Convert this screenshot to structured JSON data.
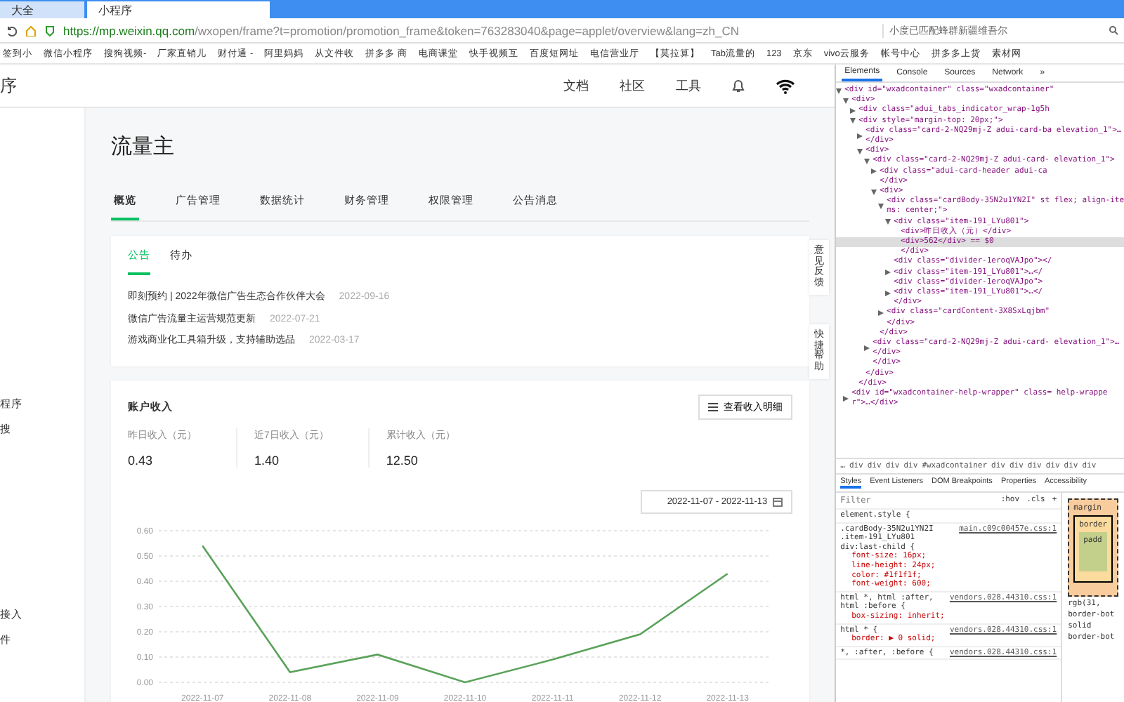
{
  "browser": {
    "tabs": [
      {
        "title": "大全",
        "selected": false
      },
      {
        "title": "小程序",
        "selected": true
      }
    ],
    "url_host": "https://mp.weixin.qq.com",
    "url_path": "/wxopen/frame?t=promotion/promotion_frame&token=763283040&page=applet/overview&lang=zh_CN",
    "search": "小度已匹配蜂群新疆维吾尔",
    "bookmarks": [
      "签到小",
      "微信小程序",
      "搜狗视频-",
      "厂家直销儿",
      "财付通 -",
      "阿里妈妈",
      "从文件收",
      "拼多多 商",
      "电商课堂",
      "快手视频互",
      "百度短网址",
      "电信营业厅",
      "【莫拉算】",
      "Tab流量的",
      "123",
      "京东",
      "vivo云服务",
      "帐号中心",
      "拼多多上货",
      "素材网"
    ]
  },
  "header": {
    "logo_fragment": "序",
    "links": [
      "文档",
      "社区",
      "工具"
    ]
  },
  "sidebar": {
    "groups": [
      {
        "items": [
          "程序",
          "搜"
        ]
      },
      {
        "items": [
          "接入",
          "件"
        ]
      }
    ]
  },
  "page": {
    "title": "流量主",
    "tabs": [
      {
        "label": "概览",
        "selected": true
      },
      {
        "label": "广告管理",
        "selected": false
      },
      {
        "label": "数据统计",
        "selected": false
      },
      {
        "label": "财务管理",
        "selected": false
      },
      {
        "label": "权限管理",
        "selected": false
      },
      {
        "label": "公告消息",
        "selected": false
      }
    ],
    "notice_card": {
      "tabs": [
        {
          "label": "公告",
          "selected": true
        },
        {
          "label": "待办",
          "selected": false
        }
      ],
      "notices": [
        {
          "text": "即刻预约 | 2022年微信广告生态合作伙伴大会",
          "date": "2022-09-16"
        },
        {
          "text": "微信广告流量主运营规范更新",
          "date": "2022-07-21"
        },
        {
          "text": "游戏商业化工具箱升级，支持辅助选品",
          "date": "2022-03-17"
        }
      ]
    },
    "income_card": {
      "title": "账户收入",
      "detail_button": "查看收入明细",
      "stats": [
        {
          "label": "昨日收入（元）",
          "value": "0.43"
        },
        {
          "label": "近7日收入（元）",
          "value": "1.40"
        },
        {
          "label": "累计收入（元）",
          "value": "12.50"
        }
      ],
      "date_range": "2022-11-07 - 2022-11-13",
      "chart_data": {
        "type": "line",
        "categories": [
          "2022-11-07",
          "2022-11-08",
          "2022-11-09",
          "2022-11-10",
          "2022-11-11",
          "2022-11-12",
          "2022-11-13"
        ],
        "grid": true,
        "series": [
          {
            "color": "#5aa25a",
            "values": [
              0.54,
              0.04,
              0.11,
              0.0,
              0.09,
              0.19,
              0.43
            ]
          }
        ],
        "ylim": [
          0,
          0.6
        ],
        "yticks": [
          {
            "value": 0,
            "label": "0.00"
          },
          {
            "value": 0.1,
            "label": "0.10"
          },
          {
            "value": 0.2,
            "label": "0.20"
          },
          {
            "value": 0.3,
            "label": "0.30"
          },
          {
            "value": 0.4,
            "label": "0.40"
          },
          {
            "value": 0.5,
            "label": "0.50"
          },
          {
            "value": 0.6,
            "label": "0.60"
          }
        ]
      }
    }
  },
  "floating_buttons": [
    "意见反馈",
    "快捷帮助"
  ],
  "devtools": {
    "tabs": [
      {
        "label": "Elements",
        "selected": true
      },
      {
        "label": "Console",
        "selected": false
      },
      {
        "label": "Sources",
        "selected": false
      },
      {
        "label": "Network",
        "selected": false
      },
      {
        "label": "»",
        "selected": false
      }
    ],
    "tree": [
      {
        "text": "<div id=\"wxadcontainer\" class=\"wxadcontainer\"",
        "kind": "expanded",
        "selected": false,
        "children": [
          {
            "text": "<div>",
            "kind": "expanded",
            "selected": false,
            "children": [
              {
                "text": "<div class=\"adui_tabs_indicator_wrap-1g5h",
                "kind": "collapsed",
                "selected": false
              },
              {
                "text": "<div style=\"margin-top: 20px;\">",
                "kind": "expanded",
                "selected": false,
                "children": [
                  {
                    "text": "<div class=\"card-2-NQ29mj-Z adui-card-ba elevation_1\">…</div>",
                    "kind": "collapsed",
                    "selected": false
                  },
                  {
                    "text": "<div>",
                    "kind": "expanded",
                    "selected": false,
                    "children": [
                      {
                        "text": "<div class=\"card-2-NQ29mj-Z adui-card- elevation_1\">",
                        "kind": "expanded",
                        "selected": false,
                        "children": [
                          {
                            "text": "<div class=\"adui-card-header adui-ca",
                            "kind": "collapsed",
                            "selected": false
                          },
                          {
                            "text": "</div>",
                            "kind": "plain",
                            "selected": false
                          },
                          {
                            "text": "<div>",
                            "kind": "expanded",
                            "selected": false,
                            "children": [
                              {
                                "text": "<div class=\"cardBody-35N2u1YN2I\" st flex; align-items: center;\">",
                                "kind": "expanded",
                                "selected": false,
                                "children": [
                                  {
                                    "text": "<div class=\"item-191_LYu801\">",
                                    "kind": "expanded",
                                    "selected": false,
                                    "children": [
                                      {
                                        "text": "<div>昨日收入（元）</div>",
                                        "kind": "plain",
                                        "selected": false
                                      },
                                      {
                                        "text": "<div>562</div> == $0",
                                        "kind": "plain",
                                        "selected": true
                                      },
                                      {
                                        "text": "</div>",
                                        "kind": "plain",
                                        "selected": false
                                      }
                                    ]
                                  },
                                  {
                                    "text": "<div class=\"divider-1eroqVAJpo\"></",
                                    "kind": "plain",
                                    "selected": false
                                  },
                                  {
                                    "text": "<div class=\"item-191_LYu801\">…</",
                                    "kind": "collapsed",
                                    "selected": false
                                  },
                                  {
                                    "text": "<div class=\"divider-1eroqVAJpo\">",
                                    "kind": "plain",
                                    "selected": false
                                  },
                                  {
                                    "text": "<div class=\"item-191_LYu801\">…</",
                                    "kind": "collapsed",
                                    "selected": false
                                  },
                                  {
                                    "text": "</div>",
                                    "kind": "plain",
                                    "selected": false
                                  }
                                ]
                              },
                              {
                                "text": "<div class=\"cardContent-3X8SxLqjbm\"",
                                "kind": "collapsed",
                                "selected": false
                              },
                              {
                                "text": "</div>",
                                "kind": "plain",
                                "selected": false
                              }
                            ]
                          },
                          {
                            "text": "</div>",
                            "kind": "plain",
                            "selected": false
                          }
                        ]
                      },
                      {
                        "text": "<div class=\"card-2-NQ29mj-Z adui-card- elevation_1\">…</div>",
                        "kind": "collapsed",
                        "selected": false
                      },
                      {
                        "text": "</div>",
                        "kind": "plain",
                        "selected": false
                      }
                    ]
                  },
                  {
                    "text": "</div>",
                    "kind": "plain",
                    "selected": false
                  }
                ]
              },
              {
                "text": "</div>",
                "kind": "plain",
                "selected": false
              }
            ]
          },
          {
            "text": "<div id=\"wxadcontainer-help-wrapper\" class= help-wrapper\">…</div>",
            "kind": "collapsed",
            "selected": false
          }
        ]
      }
    ],
    "breadcrumbs": [
      "…",
      "div",
      "div",
      "div",
      "div",
      "#wxadcontainer",
      "div",
      "div",
      "div",
      "div",
      "div",
      "div"
    ],
    "style_tabs": [
      {
        "label": "Styles",
        "selected": true
      },
      {
        "label": "Event Listeners",
        "selected": false
      },
      {
        "label": "DOM Breakpoints",
        "selected": false
      },
      {
        "label": "Properties",
        "selected": false
      },
      {
        "label": "Accessibility",
        "selected": false
      }
    ],
    "filter_placeholder": "Filter",
    "filter_buttons": [
      ":hov",
      ".cls",
      "+"
    ],
    "rules": [
      {
        "selector": "element.style {"
      },
      {
        "selector": ".cardBody-35N2u1YN2I .item-191_LYu801 div:last-child {",
        "source": "main.c09c00457e.css:1",
        "props": [
          "font-size: 16px;",
          "line-height: 24px;",
          "color: #1f1f1f;",
          "font-weight: 600;"
        ]
      },
      {
        "selector": "html *, html :after, html :before {",
        "source": "vendors.028.44310.css:1",
        "props": [
          "box-sizing: inherit;"
        ]
      },
      {
        "selector": "html * {",
        "source": "vendors.028.44310.css:1",
        "props": [
          "border: ▶ 0 solid;"
        ]
      },
      {
        "selector": "*, :after, :before {",
        "source": "vendors.028.44310.css:1"
      }
    ],
    "box_model": [
      "margin",
      "border",
      "padd"
    ],
    "computed": [
      "rgb(31,",
      "border-bot",
      "solid",
      "border-bot"
    ]
  }
}
